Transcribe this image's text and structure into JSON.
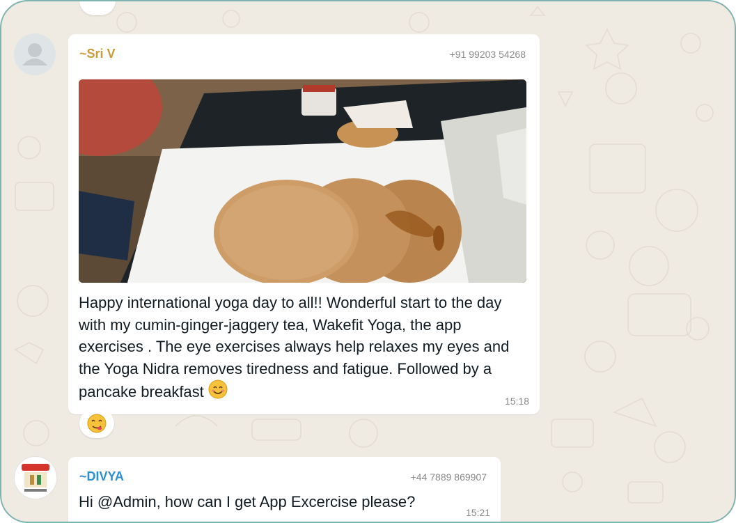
{
  "messages": [
    {
      "sender": "~Sri V",
      "phone": "+91 99203 54268",
      "text": "Happy international yoga day to all!! Wonderful start to the day with my cumin-ginger-jaggery tea, Wakefit Yoga, the app exercises . The eye exercises always help relaxes my eyes and the Yoga Nidra removes tiredness and fatigue. Followed by a pancake breakfast",
      "time": "15:18",
      "image_alt": "Pancakes with syrup on a tray",
      "reaction_icon": "smiling-face-emoji"
    },
    {
      "sender": "~DIVYA",
      "phone": "+44 7889 869907",
      "text": "Hi @Admin, how can I get App Excercise please?",
      "time": "15:21"
    }
  ],
  "colors": {
    "sender1": "#c89b3c",
    "sender2": "#2c8fd0",
    "chat_bg": "#efeae2",
    "frame_border": "#7fb3b0"
  }
}
